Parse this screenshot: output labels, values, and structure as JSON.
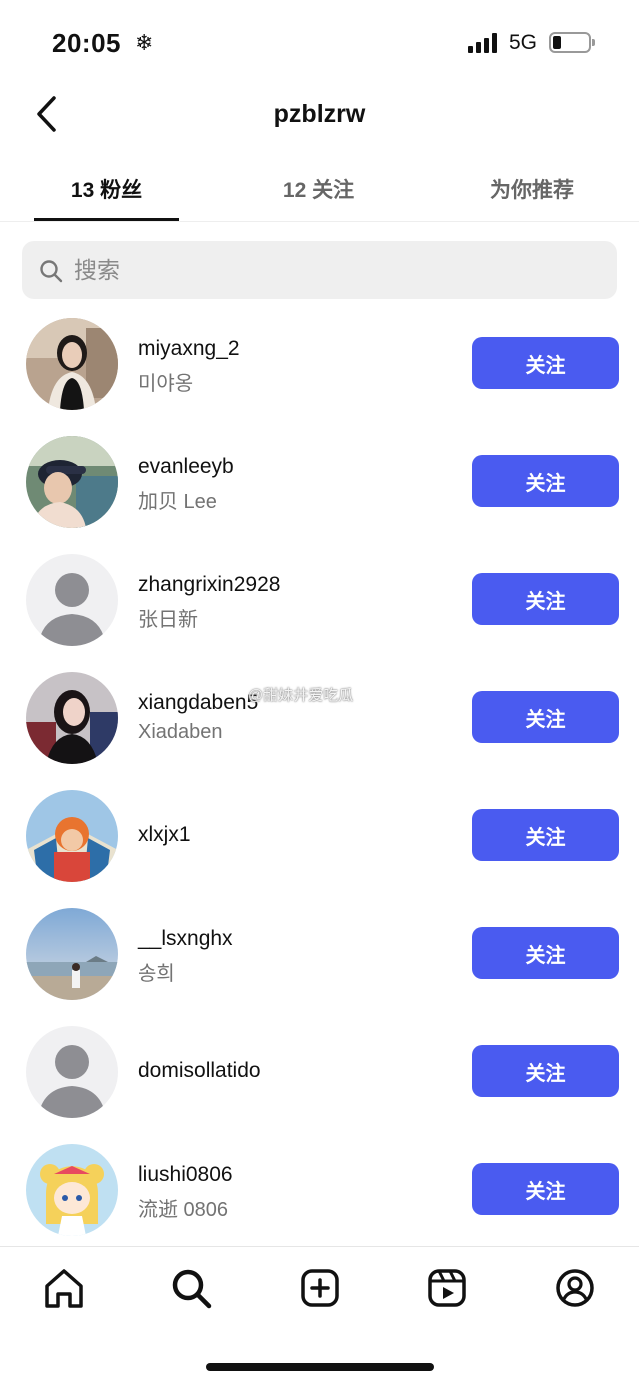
{
  "status_bar": {
    "time": "20:05",
    "weather_icon": "❄",
    "network": "5G"
  },
  "header": {
    "title": "pzblzrw"
  },
  "tabs": [
    {
      "label": "13 粉丝"
    },
    {
      "label": "12 关注"
    },
    {
      "label": "为你推荐"
    }
  ],
  "search": {
    "placeholder": "搜索"
  },
  "followers": [
    {
      "username": "miyaxng_2",
      "display_name": "미야옹",
      "button": "关注"
    },
    {
      "username": "evanleeyb",
      "display_name": "加贝 Lee",
      "button": "关注"
    },
    {
      "username": "zhangrixin2928",
      "display_name": "张日新",
      "button": "关注"
    },
    {
      "username": "xiangdaben5",
      "display_name": "Xiadaben",
      "button": "关注"
    },
    {
      "username": "xlxjx1",
      "display_name": "",
      "button": "关注"
    },
    {
      "username": "__lsxnghx",
      "display_name": "송희",
      "button": "关注"
    },
    {
      "username": "domisollatido",
      "display_name": "",
      "button": "关注"
    },
    {
      "username": "liushi0806",
      "display_name": "流逝 0806",
      "button": "关注"
    }
  ],
  "watermark": "@甜妹井爱吃瓜",
  "bottom_nav": [
    "home-icon",
    "search-icon",
    "create-icon",
    "reels-icon",
    "profile-icon"
  ],
  "colors": {
    "follow_button": "#4a5bf0"
  }
}
